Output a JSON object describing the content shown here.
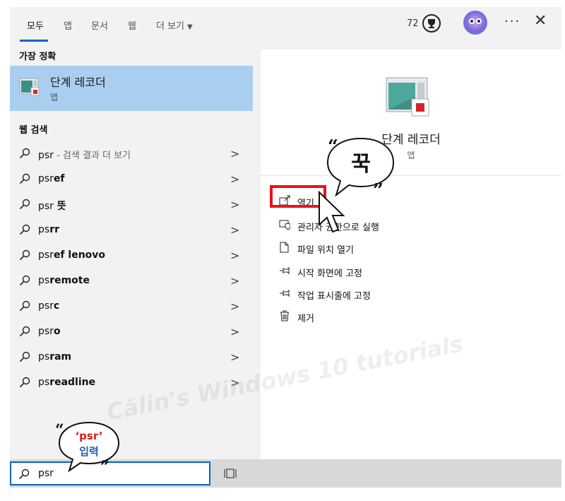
{
  "tabs": [
    {
      "label": "모두",
      "active": true
    },
    {
      "label": "앱",
      "active": false
    },
    {
      "label": "문서",
      "active": false
    },
    {
      "label": "웹",
      "active": false
    },
    {
      "label": "더 보기",
      "active": false
    }
  ],
  "header": {
    "points": "72",
    "more": "···",
    "close": "✕"
  },
  "left": {
    "best_match_title": "가장 정확",
    "best_match": {
      "title": "단계 레코더",
      "subtitle": "앱"
    },
    "web_title": "웹 검색",
    "web_results": [
      {
        "query": "psr",
        "bold": "",
        "suffix": " - 검색 결과 더 보기"
      },
      {
        "query": "psr",
        "bold": "ef",
        "suffix": ""
      },
      {
        "query": "psr",
        "bold": " 뜻",
        "suffix": ""
      },
      {
        "query": "ps",
        "bold": "rr",
        "suffix": ""
      },
      {
        "query": "psr",
        "bold": "ef lenovo",
        "suffix": ""
      },
      {
        "query": "ps",
        "bold": "remote",
        "suffix": ""
      },
      {
        "query": "psr",
        "bold": "c",
        "suffix": ""
      },
      {
        "query": "psr",
        "bold": "o",
        "suffix": ""
      },
      {
        "query": "ps",
        "bold": "ram",
        "suffix": ""
      },
      {
        "query": "ps",
        "bold": "readline",
        "suffix": ""
      }
    ]
  },
  "right": {
    "app_title": "단계 레코더",
    "app_subtitle": "앱",
    "actions": [
      "열기",
      "관리자 권한으로 실행",
      "파일 위치 열기",
      "시작 화면에 고정",
      "작업 표시줄에 고정",
      "제거"
    ]
  },
  "search": {
    "value": "psr"
  },
  "annotations": {
    "click_bubble": "꾹",
    "input_bubble_line1": "‘psr’",
    "input_bubble_line2": "입력",
    "watermark": "Călin's Windows 10 tutorials",
    "highlight_color": "#e8131b"
  },
  "colors": {
    "accent": "#0067c0",
    "selected": "#a9cef0"
  }
}
